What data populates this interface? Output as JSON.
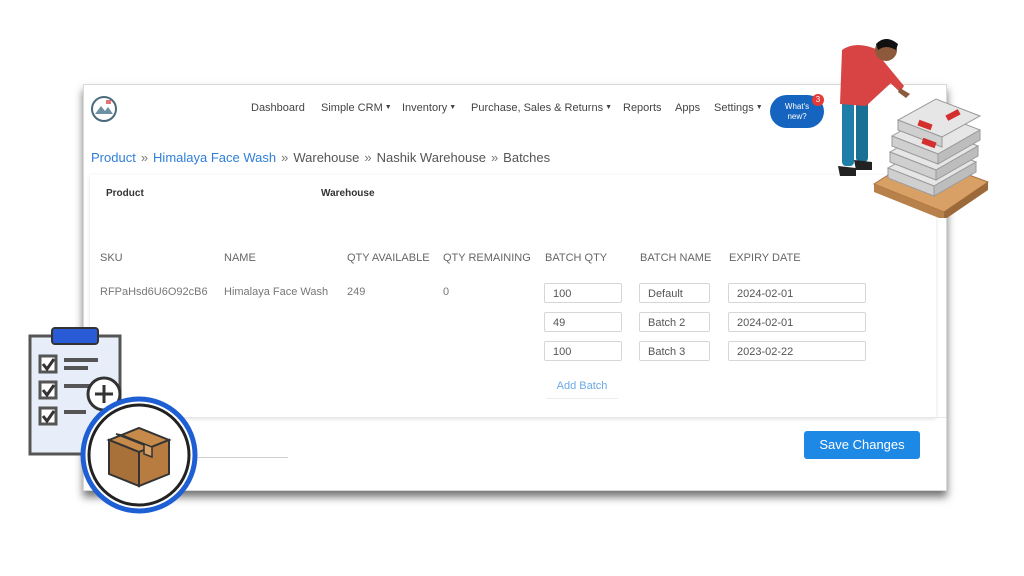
{
  "nav": {
    "items": [
      {
        "label": "Dashboard",
        "dropdown": false
      },
      {
        "label": "Simple CRM",
        "dropdown": true
      },
      {
        "label": "Inventory",
        "dropdown": true
      },
      {
        "label": "Purchase, Sales & Returns",
        "dropdown": true
      },
      {
        "label": "Reports",
        "dropdown": false
      },
      {
        "label": "Apps",
        "dropdown": false
      },
      {
        "label": "Settings",
        "dropdown": true
      }
    ],
    "whats_new": "What's new?",
    "notification_count": "3"
  },
  "breadcrumb": [
    "Product",
    "Himalaya Face Wash",
    "Warehouse",
    "Nashik Warehouse",
    "Batches"
  ],
  "breadcrumb_sep": "»",
  "sections": {
    "product": "Product",
    "warehouse": "Warehouse"
  },
  "table": {
    "headers": [
      "SKU",
      "NAME",
      "QTY AVAILABLE",
      "QTY REMAINING",
      "BATCH QTY",
      "BATCH NAME",
      "EXPIRY DATE"
    ],
    "row": {
      "sku": "RFPaHsd6U6O92cB6",
      "name": "Himalaya Face Wash",
      "qty_available": "249",
      "qty_remaining": "0"
    },
    "batches": [
      {
        "qty": "100",
        "name": "Default",
        "expiry": "2024-02-01"
      },
      {
        "qty": "49",
        "name": "Batch 2",
        "expiry": "2024-02-01"
      },
      {
        "qty": "100",
        "name": "Batch 3",
        "expiry": "2023-02-22"
      }
    ]
  },
  "add_batch_label": "Add Batch",
  "save_label": "Save Changes",
  "colors": {
    "primary": "#1e88e5",
    "link": "#2f7fd6",
    "badge": "#1565c0",
    "notification": "#e53935"
  },
  "icons": [
    "logo-icon",
    "clipboard-checklist-icon",
    "add-circle-icon",
    "box-icon"
  ]
}
